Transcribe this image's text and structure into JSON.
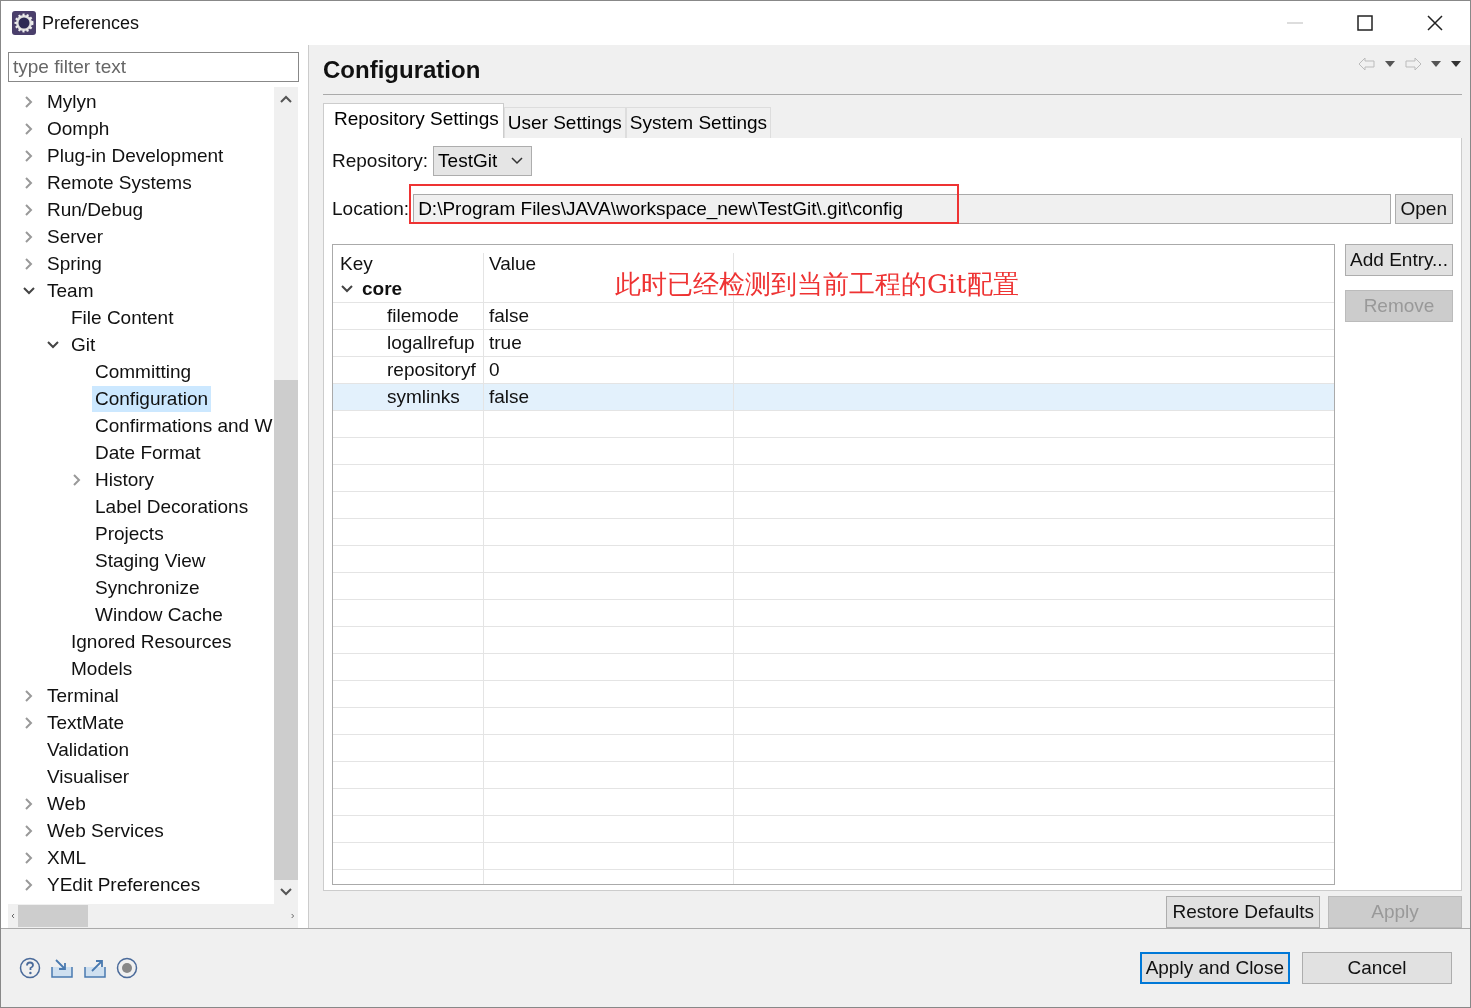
{
  "window": {
    "title": "Preferences"
  },
  "filter": {
    "placeholder": "type filter text"
  },
  "tree": [
    {
      "label": "Mylyn",
      "expanded": false,
      "selected": false
    },
    {
      "label": "Oomph",
      "expanded": false,
      "selected": false
    },
    {
      "label": "Plug-in Development",
      "expanded": false,
      "selected": false
    },
    {
      "label": "Remote Systems",
      "expanded": false,
      "selected": false
    },
    {
      "label": "Run/Debug",
      "expanded": false,
      "selected": false
    },
    {
      "label": "Server",
      "expanded": false,
      "selected": false
    },
    {
      "label": "Spring",
      "expanded": false,
      "selected": false
    },
    {
      "label": "Team",
      "expanded": true,
      "selected": false,
      "children": [
        {
          "label": "File Content",
          "selected": false
        },
        {
          "label": "Git",
          "expanded": true,
          "selected": false,
          "children": [
            {
              "label": "Committing",
              "selected": false
            },
            {
              "label": "Configuration",
              "selected": true
            },
            {
              "label": "Confirmations and W",
              "selected": false
            },
            {
              "label": "Date Format",
              "selected": false
            },
            {
              "label": "History",
              "expanded": false,
              "selected": false
            },
            {
              "label": "Label Decorations",
              "selected": false
            },
            {
              "label": "Projects",
              "selected": false
            },
            {
              "label": "Staging View",
              "selected": false
            },
            {
              "label": "Synchronize",
              "selected": false
            },
            {
              "label": "Window Cache",
              "selected": false
            }
          ]
        },
        {
          "label": "Ignored Resources",
          "selected": false
        },
        {
          "label": "Models",
          "selected": false
        }
      ]
    },
    {
      "label": "Terminal",
      "expanded": false,
      "selected": false
    },
    {
      "label": "TextMate",
      "expanded": false,
      "selected": false
    },
    {
      "label": "Validation",
      "selected": false
    },
    {
      "label": "Visualiser",
      "selected": false
    },
    {
      "label": "Web",
      "expanded": false,
      "selected": false
    },
    {
      "label": "Web Services",
      "expanded": false,
      "selected": false
    },
    {
      "label": "XML",
      "expanded": false,
      "selected": false
    },
    {
      "label": "YEdit Preferences",
      "expanded": false,
      "selected": false
    }
  ],
  "page": {
    "title": "Configuration"
  },
  "tabs": [
    {
      "label": "Repository Settings",
      "selected": true
    },
    {
      "label": "User Settings",
      "selected": false
    },
    {
      "label": "System Settings",
      "selected": false
    }
  ],
  "repository": {
    "label": "Repository:",
    "value": "TestGit"
  },
  "location": {
    "label": "Location:",
    "value": "D:\\Program Files\\JAVA\\workspace_new\\TestGit\\.git\\config",
    "button": "Open"
  },
  "table": {
    "columns": [
      "Key",
      "Value"
    ],
    "groups": [
      {
        "name": "core",
        "expanded": true,
        "rows": [
          {
            "key": "filemode",
            "value": "false",
            "selected": false
          },
          {
            "key": "logallrefup",
            "value": "true",
            "selected": false
          },
          {
            "key": "repositoryf",
            "value": "0",
            "selected": false
          },
          {
            "key": "symlinks",
            "value": "false",
            "selected": true
          }
        ]
      }
    ]
  },
  "annotation": "此时已经检测到当前工程的Git配置",
  "side_buttons": [
    {
      "label": "Add Entry...",
      "disabled": false
    },
    {
      "label": "Remove",
      "disabled": true
    }
  ],
  "page_buttons": [
    {
      "label": "Restore Defaults",
      "disabled": false
    },
    {
      "label": "Apply",
      "disabled": true
    }
  ],
  "dialog_buttons": [
    {
      "label": "Apply and Close",
      "default": true
    },
    {
      "label": "Cancel",
      "default": false
    }
  ]
}
